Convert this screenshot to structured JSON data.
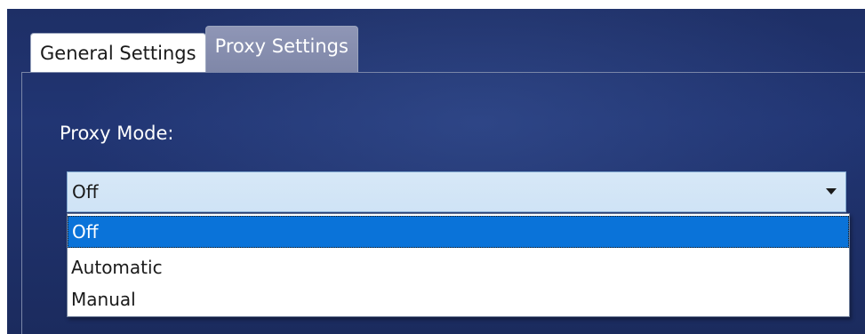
{
  "tabs": [
    {
      "label": "General Settings",
      "active": false
    },
    {
      "label": "Proxy Settings",
      "active": true
    }
  ],
  "proxy": {
    "label": "Proxy Mode:",
    "selected": "Off",
    "options": [
      "Off",
      "Automatic",
      "Manual"
    ]
  },
  "colors": {
    "window_bg": "#213573",
    "active_tab_bg": "#8a91b2",
    "combo_bg": "#cfe3f6",
    "highlight": "#0a73d9"
  },
  "icons": {
    "combo_arrow": "triangle-down"
  }
}
